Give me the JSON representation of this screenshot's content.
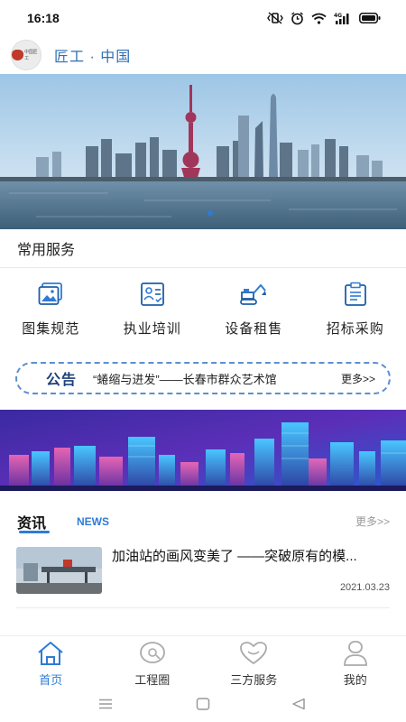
{
  "status_bar": {
    "time": "16:18",
    "icons": [
      "vibrate-icon",
      "alarm-icon",
      "wifi-icon",
      "signal-4g-icon",
      "battery-icon"
    ]
  },
  "header": {
    "logo_text": "中国匠工",
    "app_title": "匠工 · 中国"
  },
  "common_services": {
    "title": "常用服务",
    "items": [
      {
        "label": "图集规范",
        "icon": "image-gallery-icon"
      },
      {
        "label": "执业培训",
        "icon": "training-certificate-icon"
      },
      {
        "label": "设备租售",
        "icon": "excavator-icon"
      },
      {
        "label": "招标采购",
        "icon": "tender-document-icon"
      }
    ]
  },
  "notice": {
    "label": "公告",
    "text": "“蜷缩与进发”——长春市群众艺术馆",
    "more": "更多>>"
  },
  "news": {
    "tab_label": "资讯",
    "tab_label_en": "NEWS",
    "more": "更多>>",
    "items": [
      {
        "title": "加油站的画风变美了 ——突破原有的模...",
        "date": "2021.03.23"
      }
    ]
  },
  "bottom_nav": {
    "items": [
      {
        "label": "首页",
        "icon": "home-icon",
        "active": true
      },
      {
        "label": "工程圈",
        "icon": "chat-bubble-icon",
        "active": false
      },
      {
        "label": "三方服务",
        "icon": "heart-icon",
        "active": false
      },
      {
        "label": "我的",
        "icon": "user-icon",
        "active": false
      }
    ]
  },
  "system_nav": [
    "menu-icon",
    "home-square-icon",
    "back-triangle-icon"
  ],
  "colors": {
    "brand_blue": "#2e7bd6",
    "title_blue": "#2f6fb5",
    "notice_border": "#5b8fd0"
  }
}
